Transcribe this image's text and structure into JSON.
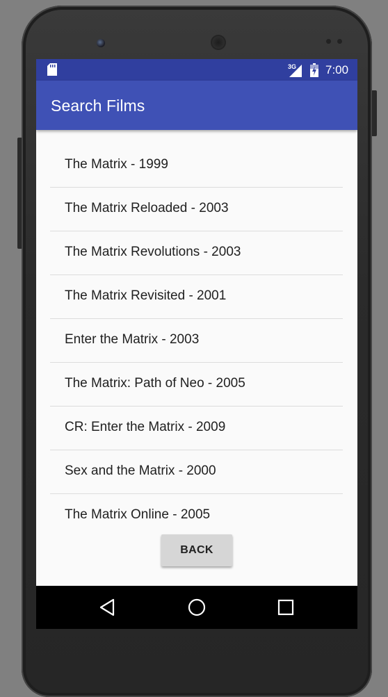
{
  "status_bar": {
    "network": "3G",
    "time": "7:00",
    "icons": [
      "sd-card-icon",
      "signal-icon",
      "battery-charging-icon"
    ]
  },
  "app_bar": {
    "title": "Search Films"
  },
  "films": [
    "The Matrix - 1999",
    "The Matrix Reloaded - 2003",
    "The Matrix Revolutions - 2003",
    "The Matrix Revisited - 2001",
    "Enter the Matrix - 2003",
    "The Matrix: Path of Neo - 2005",
    "CR: Enter the Matrix - 2009",
    "Sex and the Matrix - 2000",
    "The Matrix Online - 2005"
  ],
  "back_button": {
    "label": "BACK"
  },
  "nav_bar": {
    "icons": [
      "back-triangle-icon",
      "home-circle-icon",
      "recents-square-icon"
    ]
  },
  "colors": {
    "status_bar": "#303f9f",
    "app_bar": "#3f51b5",
    "background": "#fafafa",
    "button": "#d6d6d6"
  }
}
